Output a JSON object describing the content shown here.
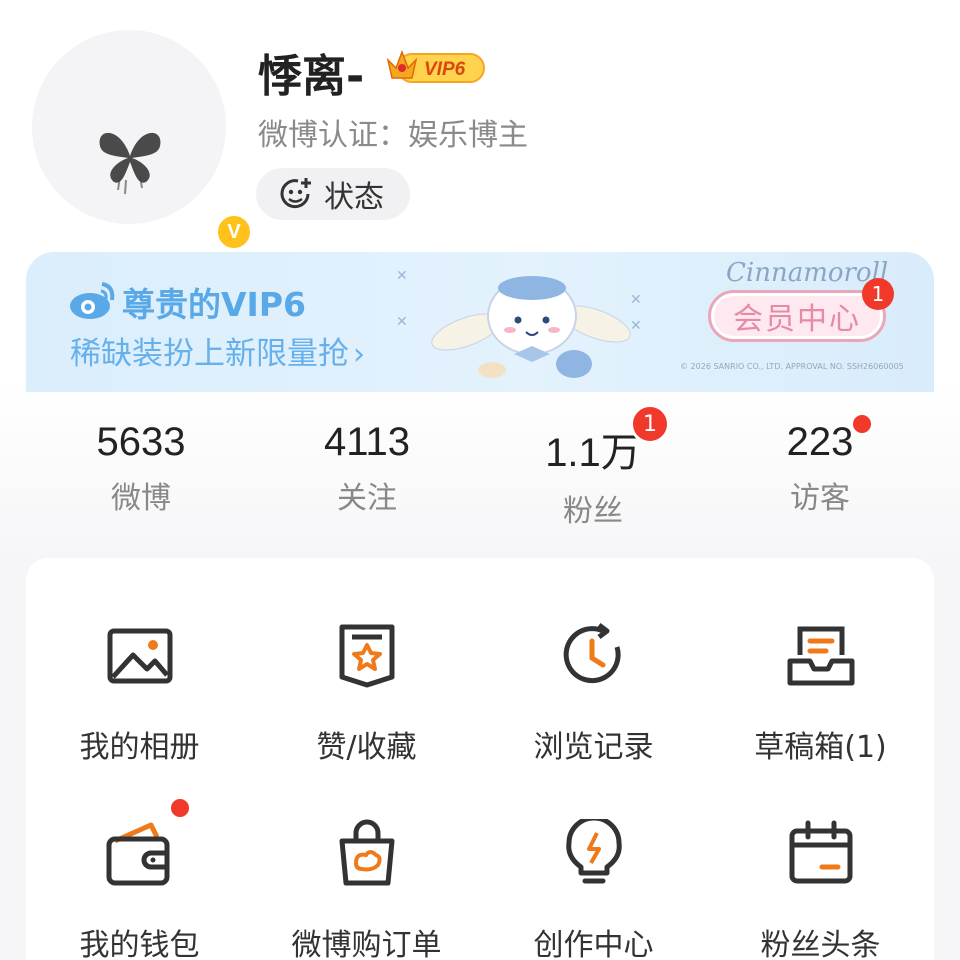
{
  "profile": {
    "username": "悸离-",
    "vip_level": "VIP6",
    "verification": "微博认证：娱乐博主",
    "status_label": "状态",
    "verified_badge": "V"
  },
  "vip_banner": {
    "title": "尊贵的VIP6",
    "subtitle": "稀缺装扮上新限量抢",
    "brand": "Cinnamoroll",
    "member_center": "会员中心",
    "member_badge": "1",
    "copyright": "© 2026 SANRIO CO., LTD. APPROVAL NO. SSH26060005"
  },
  "stats": [
    {
      "value": "5633",
      "label": "微博"
    },
    {
      "value": "4113",
      "label": "关注"
    },
    {
      "value": "1.1万",
      "label": "粉丝",
      "badge": "1"
    },
    {
      "value": "223",
      "label": "访客"
    }
  ],
  "grid": [
    {
      "label": "我的相册",
      "icon": "photo-album-icon"
    },
    {
      "label": "赞/收藏",
      "icon": "favorites-icon"
    },
    {
      "label": "浏览记录",
      "icon": "history-icon"
    },
    {
      "label": "草稿箱(1)",
      "icon": "drafts-icon"
    },
    {
      "label": "我的钱包",
      "icon": "wallet-icon"
    },
    {
      "label": "微博购订单",
      "icon": "shopping-bag-icon"
    },
    {
      "label": "创作中心",
      "icon": "lightbulb-icon"
    },
    {
      "label": "粉丝头条",
      "icon": "calendar-icon"
    }
  ],
  "colors": {
    "accent_orange": "#f07a1a",
    "badge_red": "#f0392b",
    "vip_blue": "#59a8e7",
    "verified_yellow": "#ffc21b"
  }
}
